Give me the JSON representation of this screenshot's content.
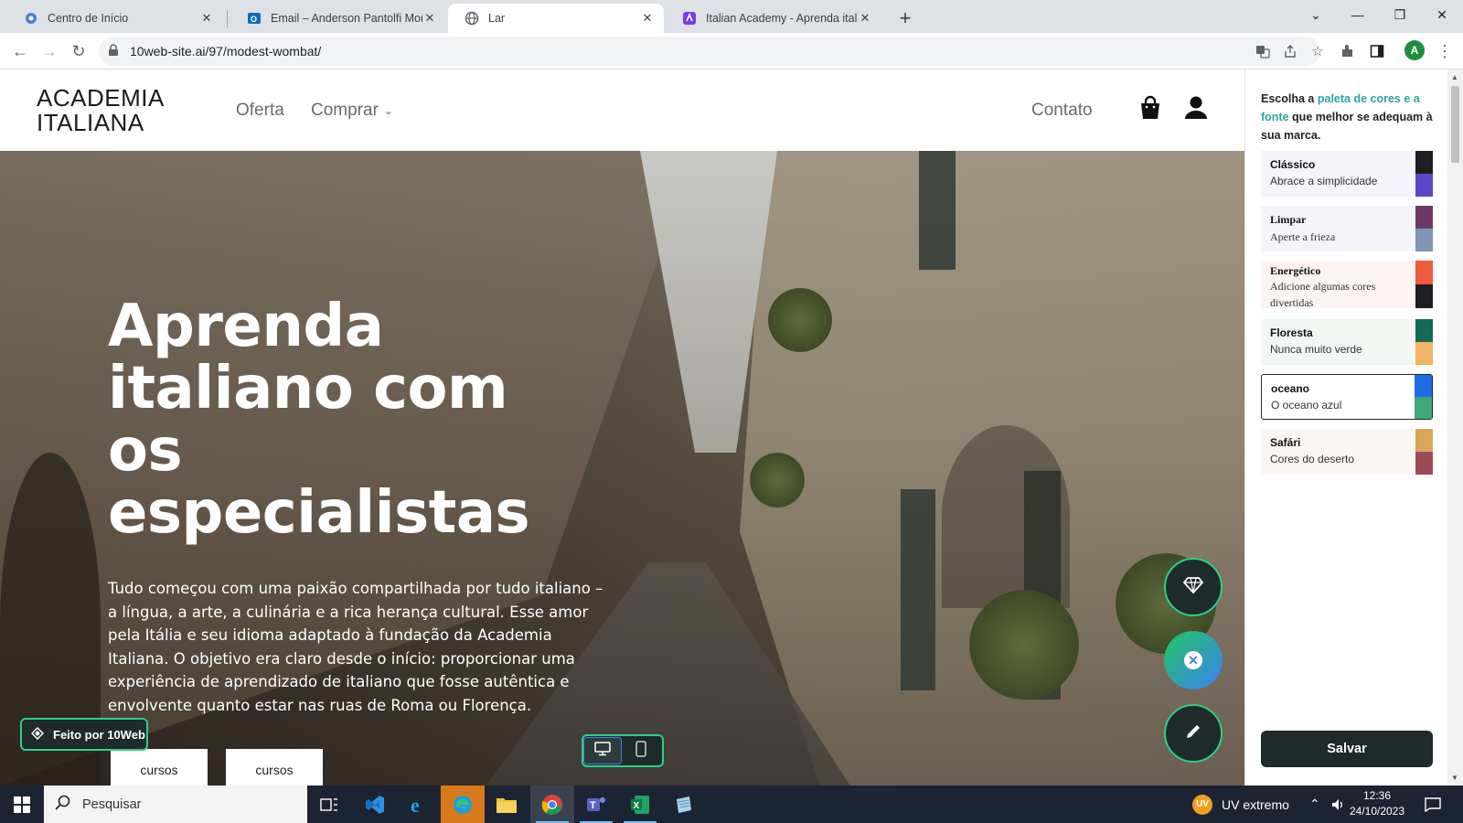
{
  "browser": {
    "tabs": [
      {
        "title": "Centro de Início",
        "favicon": "gear-flower-icon",
        "active": false
      },
      {
        "title": "Email – Anderson Pantolfi Morac",
        "favicon": "outlook-icon",
        "active": false
      },
      {
        "title": "Lar",
        "favicon": "globe-icon",
        "active": true
      },
      {
        "title": "Italian Academy - Aprenda italia",
        "favicon": "10web-icon",
        "active": false
      }
    ],
    "url": "10web-site.ai/97/modest-wombat/",
    "profile_initial": "A"
  },
  "site": {
    "logo_line1": "ACADEMIA",
    "logo_line2": "ITALIANA",
    "nav": {
      "offer": "Oferta",
      "buy": "Comprar",
      "contact": "Contato"
    },
    "hero": {
      "title": "Aprenda italiano com os especialistas",
      "body": "Tudo começou com uma paixão compartilhada por tudo italiano – a língua, a arte, a culinária e a rica herança cultural. Esse amor pela Itália e seu idioma adaptado à fundação da Academia Italiana. O objetivo era claro desde o início: proporcionar uma experiência de aprendizado de italiano que fosse autêntica e envolvente quanto estar nas ruas de Roma ou Florença.",
      "button1": "cursos",
      "button2": "cursos"
    },
    "made_by": "Feito por 10Web"
  },
  "panel": {
    "intro_pre": "Escolha a",
    "intro_hl1": "paleta de cores e a",
    "intro_hl2": "fonte",
    "intro_post": "que melhor se adequam à sua marca.",
    "palettes": [
      {
        "name": "Clássico",
        "subtitle": "Abrace a simplicidade",
        "colors": [
          "#1e1e22",
          "#5b45c9"
        ]
      },
      {
        "name": "Limpar",
        "subtitle": "Aperte a frieza",
        "colors": [
          "#6e3a64",
          "#7f95b3"
        ]
      },
      {
        "name": "Energético",
        "subtitle": "Adicione algumas cores divertidas",
        "colors": [
          "#ef5a3c",
          "#1e1e22"
        ]
      },
      {
        "name": "Floresta",
        "subtitle": "Nunca muito verde",
        "colors": [
          "#156b54",
          "#f0b466"
        ]
      },
      {
        "name": "oceano",
        "subtitle": "O oceano azul",
        "colors": [
          "#1e6be6",
          "#3ea87a"
        ],
        "selected": true
      },
      {
        "name": "Safári",
        "subtitle": "Cores do deserto",
        "colors": [
          "#d8a85a",
          "#9a4a56"
        ]
      }
    ],
    "save": "Salvar"
  },
  "taskbar": {
    "search_placeholder": "Pesquisar",
    "weather": "UV extremo",
    "weather_badge": "UV",
    "time": "12:36",
    "date": "24/10/2023"
  },
  "colors": {
    "accent_green": "#2ad18a",
    "dark": "#1f2a2a",
    "highlight_teal": "#2aa3a3"
  }
}
